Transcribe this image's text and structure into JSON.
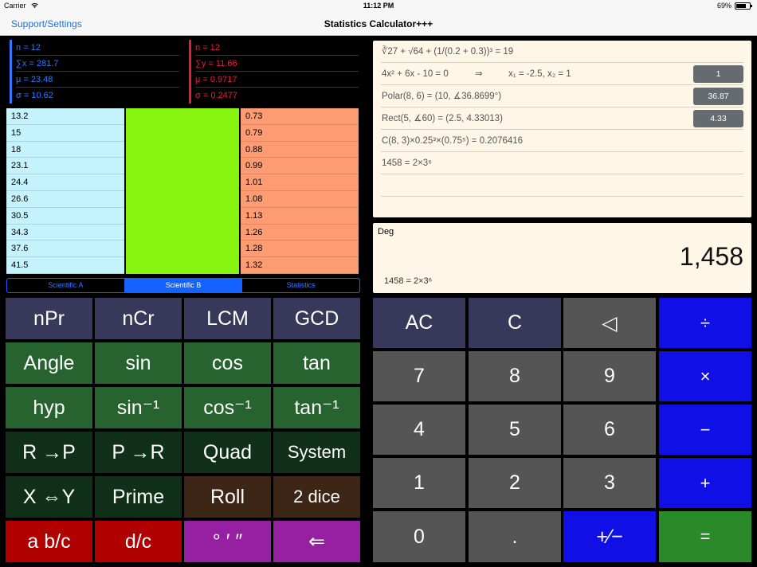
{
  "status": {
    "carrier": "Carrier",
    "time": "11:12 PM",
    "battery": "69%"
  },
  "nav": {
    "back_label": "Support/Settings",
    "title": "Statistics Calculator+++"
  },
  "summary": {
    "x": {
      "n": "n = 12",
      "sum": "∑x = 281.7",
      "mean": "μ = 23.48",
      "sd": "σ = 10.62"
    },
    "y": {
      "n": "n = 12",
      "sum": "∑y = 11.66",
      "mean": "μ = 0.9717",
      "sd": "σ = 0.2477"
    }
  },
  "columns": {
    "x_values": [
      "13.2",
      "15",
      "18",
      "23.1",
      "24.4",
      "26.6",
      "30.5",
      "34.3",
      "37.6",
      "41.5"
    ],
    "y_values": [
      "0.73",
      "0.79",
      "0.88",
      "0.99",
      "1.01",
      "1.08",
      "1.13",
      "1.26",
      "1.28",
      "1.32"
    ]
  },
  "tabs": [
    "Scientific A",
    "Scientific B",
    "Statistics"
  ],
  "active_tab": "Scientific B",
  "left_keys": {
    "row1": [
      "nPr",
      "nCr",
      "LCM",
      "GCD"
    ],
    "row2": [
      "Angle",
      "sin",
      "cos",
      "tan"
    ],
    "row3": [
      "hyp",
      "sin⁻¹",
      "cos⁻¹",
      "tan⁻¹"
    ],
    "row4": [
      "R →P",
      "P →R",
      "Quad",
      "System"
    ],
    "row5": [
      "X ⇔Y",
      "Prime",
      "Roll",
      "2 dice"
    ],
    "row6": [
      "a b/c",
      "d/c",
      "° ′ ″",
      "⇐"
    ]
  },
  "right_keys": {
    "row1": [
      "AC",
      "C",
      "◁",
      "÷"
    ],
    "row2": [
      "7",
      "8",
      "9",
      "×"
    ],
    "row3": [
      "4",
      "5",
      "6",
      "−"
    ],
    "row4": [
      "1",
      "2",
      "3",
      "+"
    ],
    "row5": [
      "0",
      ".",
      "+∕−",
      "="
    ]
  },
  "history": {
    "row1": "∛27 + √64 + (1/(0.2 + 0.3))³ = 19",
    "row2_eq": "4x² + 6x - 10 = 0",
    "row2_arrow": "⇒",
    "row2_roots": "x₁ = -2.5, x₂ = 1",
    "row2_btn": "1",
    "row3": "Polar(8, 6) = (10, ∡36.8699°)",
    "row3_btn": "36.87",
    "row4": "Rect(5, ∡60) = (2.5, 4.33013)",
    "row4_btn": "4.33",
    "row5": "C(8, 3)×0.25³×(0.75⁵) = 0.2076416",
    "row6": "1458 = 2×3⁶"
  },
  "display": {
    "mode": "Deg",
    "value": "1,458",
    "sub": "1458 = 2×3⁶"
  },
  "colors": {
    "x_accent": "#2e7bff",
    "y_accent": "#e0203a",
    "col_x": "#c4f2fd",
    "col_mid": "#86f40f",
    "col_y": "#fd9b72",
    "key_navy": "#38385a",
    "key_green": "#27632f",
    "key_darkgreen": "#10301a",
    "key_brown": "#3d2615",
    "key_red": "#b00000",
    "key_purple": "#9520a2",
    "key_gray": "#555555",
    "key_blue": "#1010e6",
    "key_eq_green": "#2a8a2a",
    "history_bg": "#fef6e6"
  }
}
